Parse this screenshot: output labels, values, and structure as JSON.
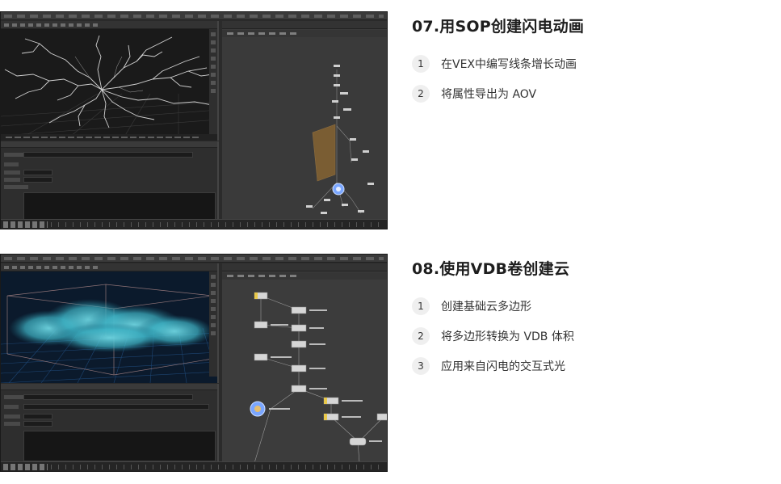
{
  "lessons": [
    {
      "title": "07.用SOP创建闪电动画",
      "screenshot_icon": "houdini-lightning-sop-screenshot",
      "steps": [
        {
          "num": "1",
          "text": "在VEX中编写线条增长动画"
        },
        {
          "num": "2",
          "text": "将属性导出为 AOV"
        }
      ]
    },
    {
      "title": "08.使用VDB卷创建云",
      "screenshot_icon": "houdini-vdb-cloud-screenshot",
      "steps": [
        {
          "num": "1",
          "text": "创建基础云多边形"
        },
        {
          "num": "2",
          "text": "将多边形转换为 VDB 体积"
        },
        {
          "num": "3",
          "text": "应用来自闪电的交互式光"
        }
      ]
    }
  ],
  "colors": {
    "ui_dark": "#2b2b2b",
    "lightning": "#e8e8e8",
    "cloud": "#3fb6c8",
    "grid": "#1f4a7a",
    "node_selected": "#b07a2e"
  }
}
